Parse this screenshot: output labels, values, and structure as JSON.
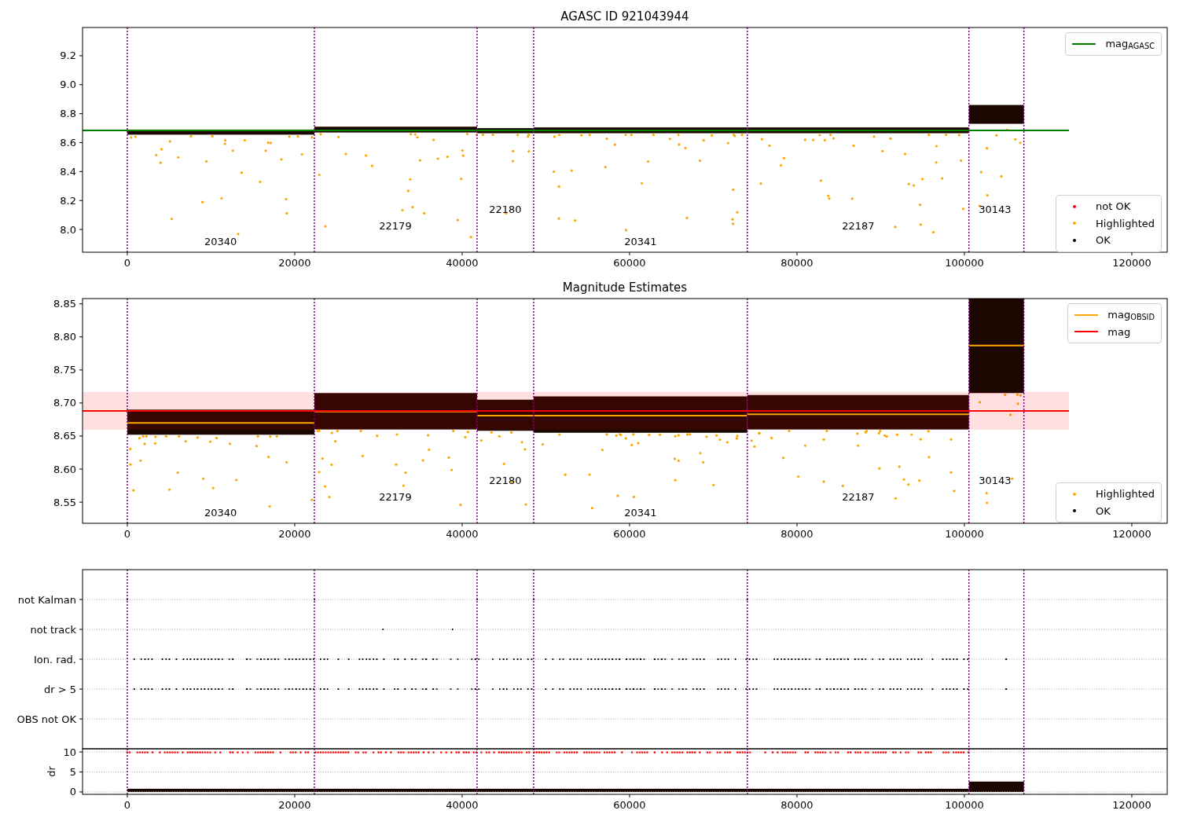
{
  "panels": [
    {
      "kind": "scatter",
      "chart_data": {
        "type": "scatter",
        "title": "AGASC ID 921043944",
        "xlim": [
          -5350,
          124230
        ],
        "ylim": [
          7.843,
          9.395
        ],
        "xticks": [
          0,
          20000,
          40000,
          60000,
          80000,
          100000,
          120000
        ],
        "yticks": [
          {
            "value": 8.0,
            "label": "8.0"
          },
          {
            "value": 8.2,
            "label": "8.2"
          },
          {
            "value": 8.4,
            "label": "8.4"
          },
          {
            "value": 8.6,
            "label": "8.6"
          },
          {
            "value": 8.8,
            "label": "8.8"
          },
          {
            "value": 9.0,
            "label": "9.0"
          },
          {
            "value": 9.2,
            "label": "9.2"
          }
        ],
        "series": [
          {
            "name": "mag$_{AGASC}$",
            "type": "line",
            "color": "#008000",
            "x": [
              -5350,
              112500
            ],
            "values": [
              8.684,
              8.684
            ]
          }
        ],
        "ref_lines": [
          {
            "axis": "x",
            "value": 0,
            "color": "#800080"
          },
          {
            "axis": "x",
            "value": 22350,
            "color": "#800080"
          },
          {
            "axis": "x",
            "value": 41780,
            "color": "#800080"
          },
          {
            "axis": "x",
            "value": 48540,
            "color": "#800080"
          },
          {
            "axis": "x",
            "value": 74070,
            "color": "#800080"
          },
          {
            "axis": "x",
            "value": 100540,
            "color": "#800080"
          },
          {
            "axis": "x",
            "value": 107110,
            "color": "#800080"
          }
        ],
        "annotations": [
          "20340",
          "22179",
          "22180",
          "20341",
          "22187",
          "30143"
        ]
      },
      "legends": [
        {
          "entries": [
            {
              "kind": "line"
            }
          ]
        },
        {
          "entries": [
            {
              "kind": "dot",
              "label": "not OK",
              "color": "#ff0000"
            },
            {
              "kind": "dot",
              "label": "Highlighted",
              "color": "#ffa500"
            },
            {
              "kind": "dot",
              "label": "OK",
              "color": "#000000"
            }
          ]
        }
      ]
    },
    {
      "kind": "scatter",
      "chart_data": {
        "type": "scatter",
        "title": "Magnitude Estimates",
        "xlim": [
          -5350,
          124230
        ],
        "ylim": [
          8.518,
          8.858
        ],
        "xticks": [
          0,
          20000,
          40000,
          60000,
          80000,
          100000,
          120000
        ],
        "yticks": [
          {
            "value": 8.55,
            "label": "8.55"
          },
          {
            "value": 8.6,
            "label": "8.60"
          },
          {
            "value": 8.65,
            "label": "8.65"
          },
          {
            "value": 8.7,
            "label": "8.70"
          },
          {
            "value": 8.75,
            "label": "8.75"
          },
          {
            "value": 8.8,
            "label": "8.80"
          },
          {
            "value": 8.85,
            "label": "8.85"
          }
        ],
        "series": [
          {
            "name": "mag$_{OBSID}$",
            "type": "line",
            "color": "#ffa500",
            "x": [
              0,
              22350,
              null,
              22350,
              41780,
              null,
              41780,
              48540,
              null,
              48540,
              74070,
              null,
              74070,
              100540,
              null,
              100540,
              107110
            ],
            "values": [
              8.67,
              8.67,
              null,
              8.687,
              8.687,
              null,
              8.681,
              8.681,
              null,
              8.681,
              8.681,
              null,
              8.683,
              8.683,
              null,
              8.787,
              8.787
            ]
          },
          {
            "name": "mag",
            "type": "line",
            "color": "#ff0000",
            "x": [
              -5350,
              112500
            ],
            "values": [
              8.688,
              8.688
            ]
          }
        ],
        "bands": [
          {
            "axis": "y",
            "from": 8.6595,
            "to": 8.7167,
            "color": "#ff0000"
          }
        ],
        "ref_lines": [
          {
            "axis": "x",
            "value": 0,
            "color": "#800080"
          },
          {
            "axis": "x",
            "value": 22350,
            "color": "#800080"
          },
          {
            "axis": "x",
            "value": 41780,
            "color": "#800080"
          },
          {
            "axis": "x",
            "value": 48540,
            "color": "#800080"
          },
          {
            "axis": "x",
            "value": 74070,
            "color": "#800080"
          },
          {
            "axis": "x",
            "value": 100540,
            "color": "#800080"
          },
          {
            "axis": "x",
            "value": 107110,
            "color": "#800080"
          }
        ],
        "annotations": [
          "20340",
          "22179",
          "22180",
          "20341",
          "22187",
          "30143"
        ]
      },
      "legends": [
        {
          "entries": [
            {
              "kind": "line"
            },
            {
              "kind": "line"
            }
          ]
        },
        {
          "entries": [
            {
              "kind": "dot",
              "label": "Highlighted",
              "color": "#ffa500"
            },
            {
              "kind": "dot",
              "label": "OK",
              "color": "#000000"
            }
          ]
        }
      ]
    },
    {
      "kind": "flags",
      "chart_data": {
        "type": "scatter",
        "xlim": [
          -5350,
          124230
        ],
        "orientation": "horizontal",
        "categories": [
          "not Kalman",
          "not track",
          "Ion. rad.",
          "dr > 5",
          "OBS not OK"
        ],
        "grid": true,
        "ref_lines": [
          {
            "axis": "x",
            "value": 0,
            "color": "#800080"
          },
          {
            "axis": "x",
            "value": 22350,
            "color": "#800080"
          },
          {
            "axis": "x",
            "value": 41780,
            "color": "#800080"
          },
          {
            "axis": "x",
            "value": 48540,
            "color": "#800080"
          },
          {
            "axis": "x",
            "value": 74070,
            "color": "#800080"
          },
          {
            "axis": "x",
            "value": 100540,
            "color": "#800080"
          },
          {
            "axis": "x",
            "value": 107110,
            "color": "#800080"
          }
        ]
      }
    },
    {
      "kind": "dr",
      "chart_data": {
        "type": "scatter",
        "xlim": [
          -5350,
          124230
        ],
        "ylim": [
          -0.6,
          10.8
        ],
        "ylabel": "dr",
        "grid": true,
        "xticks": [
          0,
          20000,
          40000,
          60000,
          80000,
          100000,
          120000
        ],
        "yticks": [
          0,
          5,
          10
        ],
        "ref_lines": [
          {
            "axis": "x",
            "value": 0,
            "color": "#800080"
          },
          {
            "axis": "x",
            "value": 22350,
            "color": "#800080"
          },
          {
            "axis": "x",
            "value": 41780,
            "color": "#800080"
          },
          {
            "axis": "x",
            "value": 48540,
            "color": "#800080"
          },
          {
            "axis": "x",
            "value": 74070,
            "color": "#800080"
          },
          {
            "axis": "x",
            "value": 100540,
            "color": "#800080"
          },
          {
            "axis": "x",
            "value": 107110,
            "color": "#800080"
          }
        ]
      }
    }
  ]
}
